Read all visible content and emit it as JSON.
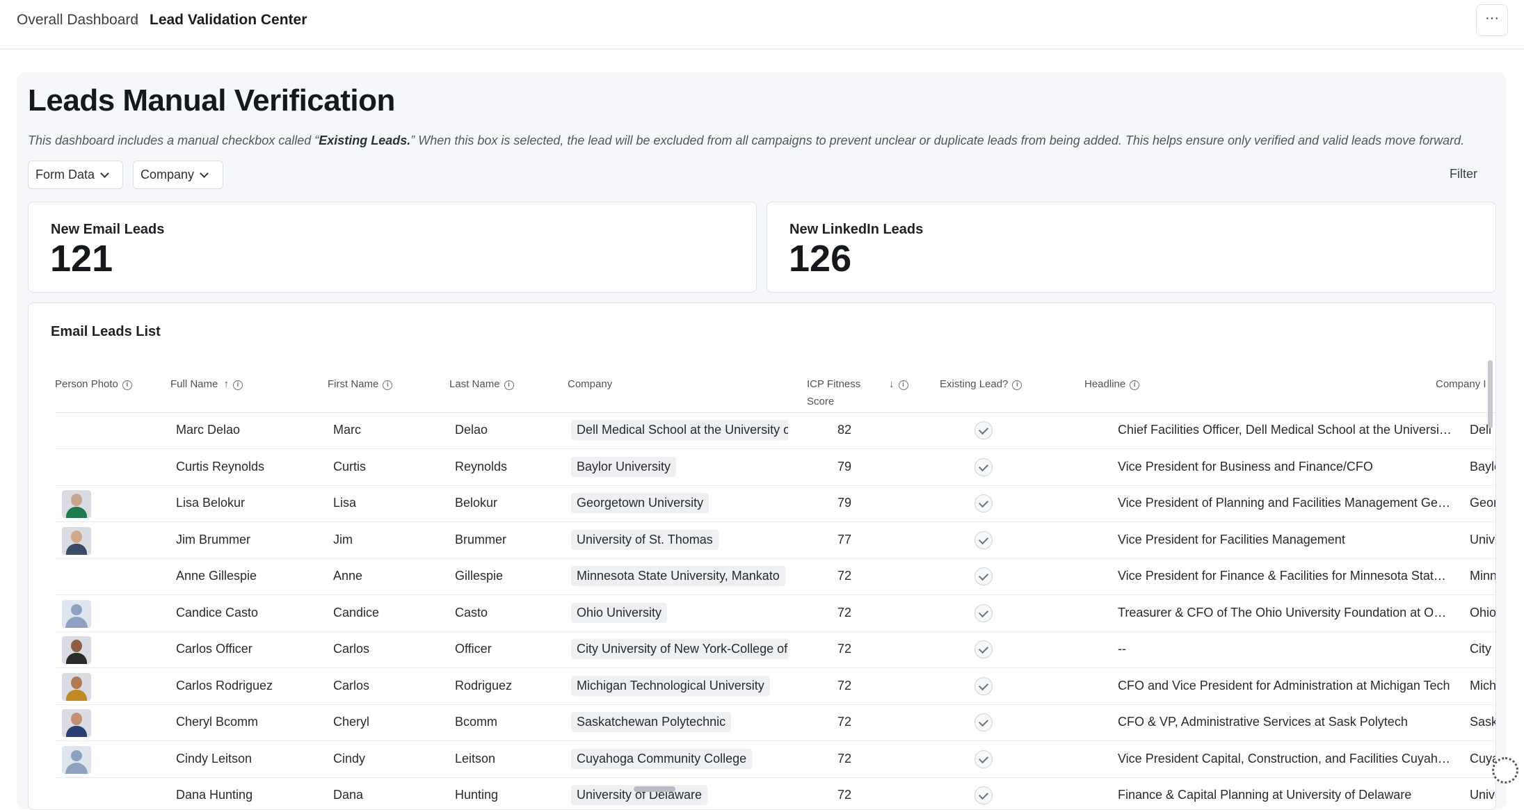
{
  "breadcrumb": {
    "root": "Overall Dashboard",
    "current": "Lead Validation Center",
    "more_label": "···"
  },
  "page": {
    "title": "Leads Manual Verification",
    "desc_prefix": "This dashboard includes a manual checkbox called “",
    "desc_bold": "Existing Leads.",
    "desc_suffix": "” When this box is selected, the lead will be excluded from all campaigns to prevent unclear or duplicate leads from being added. This helps ensure only verified and valid leads move forward."
  },
  "filters": {
    "form_data": "Form Data",
    "company": "Company",
    "filter": "Filter"
  },
  "cards": {
    "email": {
      "label": "New Email Leads",
      "value": "121"
    },
    "linkedin": {
      "label": "New LinkedIn Leads",
      "value": "126"
    }
  },
  "table": {
    "title": "Email Leads List",
    "columns": {
      "photo": "Person Photo",
      "full": "Full Name",
      "first": "First Name",
      "last": "Last Name",
      "company": "Company",
      "icp_1": "ICP Fitness",
      "icp_2": "Score",
      "existing": "Existing Lead?",
      "headline": "Headline",
      "company2": "Company I"
    },
    "rows": [
      {
        "photo": "none",
        "full": "Marc Delao",
        "first": "Marc",
        "last": "Delao",
        "company": "Dell Medical School at the University of",
        "icp": "82",
        "headline": "Chief Facilities Officer, Dell Medical School at the University ...",
        "company2": "Dell Me"
      },
      {
        "photo": "none",
        "full": "Curtis Reynolds",
        "first": "Curtis",
        "last": "Reynolds",
        "company": "Baylor University",
        "icp": "79",
        "headline": "Vice President for Business and Finance/CFO",
        "company2": "Baylor U"
      },
      {
        "photo": "woman-dark",
        "full": "Lisa Belokur",
        "first": "Lisa",
        "last": "Belokur",
        "company": "Georgetown University",
        "icp": "79",
        "headline": "Vice President of Planning and Facilities Management Geor...",
        "company2": "Georget"
      },
      {
        "photo": "man-suit",
        "full": "Jim Brummer",
        "first": "Jim",
        "last": "Brummer",
        "company": "University of St. Thomas",
        "icp": "77",
        "headline": "Vice President for Facilities Management",
        "company2": "Universi"
      },
      {
        "photo": "none",
        "full": "Anne Gillespie",
        "first": "Anne",
        "last": "Gillespie",
        "company": "Minnesota State University, Mankato",
        "icp": "72",
        "headline": "Vice President for Finance & Facilities for Minnesota State U...",
        "company2": "Minnesc"
      },
      {
        "photo": "generic",
        "full": "Candice Casto",
        "first": "Candice",
        "last": "Casto",
        "company": "Ohio University",
        "icp": "72",
        "headline": "Treasurer & CFO of The Ohio University Foundation at Ohio...",
        "company2": "Ohio Ur"
      },
      {
        "photo": "man-beard",
        "full": "Carlos Officer",
        "first": "Carlos",
        "last": "Officer",
        "company": "City University of New York-College of S",
        "icp": "72",
        "headline": "--",
        "company2": "City Uni"
      },
      {
        "photo": "man-outdoor",
        "full": "Carlos Rodriguez",
        "first": "Carlos",
        "last": "Rodriguez",
        "company": "Michigan Technological University",
        "icp": "72",
        "headline": "CFO and Vice President for Administration at Michigan Tech",
        "company2": "Michiga"
      },
      {
        "photo": "woman-curly",
        "full": "Cheryl Bcomm",
        "first": "Cheryl",
        "last": "Bcomm",
        "company": "Saskatchewan Polytechnic",
        "icp": "72",
        "headline": "CFO & VP, Administrative Services at Sask Polytech",
        "company2": "Saskatcl"
      },
      {
        "photo": "generic",
        "full": "Cindy Leitson",
        "first": "Cindy",
        "last": "Leitson",
        "company": "Cuyahoga Community College",
        "icp": "72",
        "headline": "Vice President Capital, Construction, and Facilities Cuyahog...",
        "company2": "Cuyahoc"
      },
      {
        "photo": "none",
        "full": "Dana Hunting",
        "first": "Dana",
        "last": "Hunting",
        "company": "University of Delaware",
        "icp": "72",
        "headline": "Finance & Capital Planning at University of Delaware",
        "company2": "Universi"
      }
    ]
  }
}
